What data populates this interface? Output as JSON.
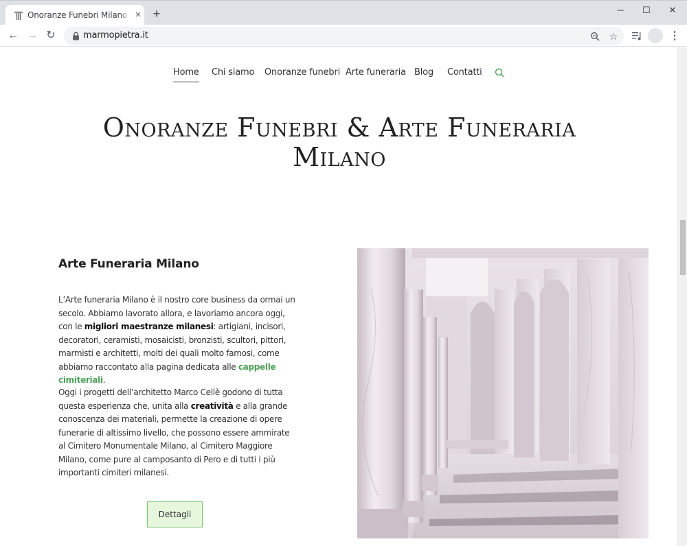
{
  "browser": {
    "tab_title": "Onoranze Funebri Milano e Arte",
    "url": "marmopietra.it"
  },
  "nav": {
    "items": [
      {
        "label": "Home",
        "active": true
      },
      {
        "label": "Chi siamo",
        "active": false
      },
      {
        "label": "Onoranze funebri",
        "active": false
      },
      {
        "label": "Arte funeraria",
        "active": false
      },
      {
        "label": "Blog",
        "active": false
      },
      {
        "label": "Contatti",
        "active": false
      }
    ],
    "search_icon": "search-icon"
  },
  "hero": {
    "title_line1": "Onoranze Funebri & Arte Funeraria",
    "title_line2": "Milano"
  },
  "section": {
    "title": "Arte Funeraria Milano",
    "p1_a": "L’Arte funeraria Milano è il nostro core business da ormai un secolo. Abbiamo lavorato allora, e lavoriamo ancora oggi, con le ",
    "p1_bold": "migliori maestranze milanesi",
    "p1_b": ": artigiani, incisori, decoratori, ceramisti, mosaicisti, bronzisti, scultori, pittori, marmisti e architetti, molti dei quali molto famosi, come abbiamo raccontato alla pagina dedicata alle ",
    "p1_link": "cappelle cimiteriali",
    "p1_c": ".",
    "p2_a": "Oggi i progetti dell’architetto Marco Cellè godono di tutta questa esperienza che, unita alla ",
    "p2_bold": "creatività",
    "p2_b": " e alla grande conoscenza dei materiali, permette la creazione di opere funerarie di altissimo livello, che possono essere ammirate al Cimitero Monumentale Milano, al Cimitero Maggiore Milano, come pure al camposanto di Pero e di tutti i più importanti cimiteri milanesi.",
    "button_label": "Dettagli"
  },
  "colors": {
    "accent_green": "#4ea058",
    "button_bg": "#e6f7de",
    "button_border": "#7fc073"
  }
}
